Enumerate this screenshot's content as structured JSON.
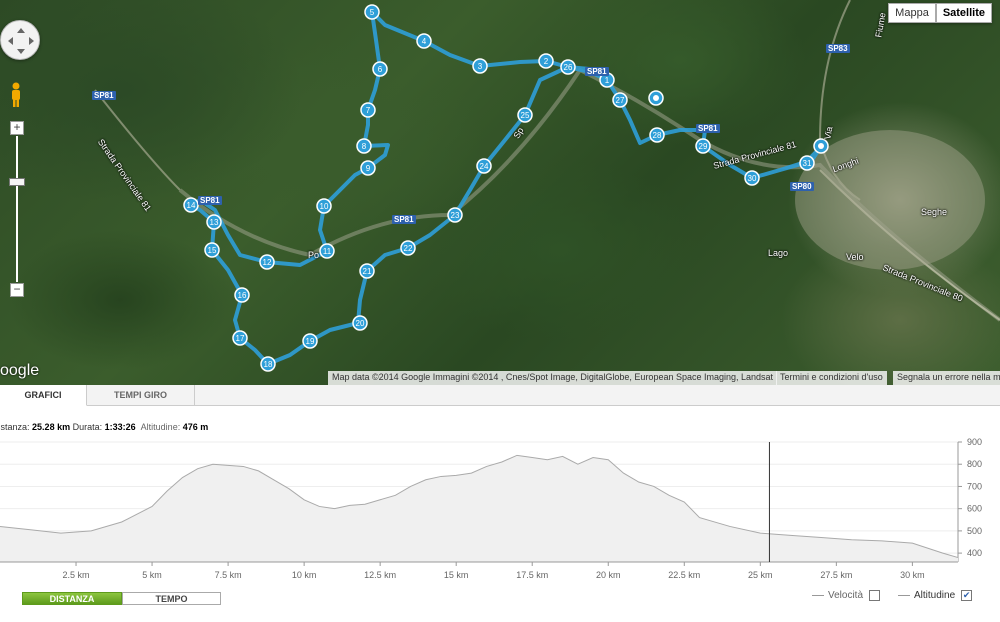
{
  "map": {
    "type_buttons": [
      "Mappa",
      "Satellite"
    ],
    "active_type": "Satellite",
    "google_logo": "oogle",
    "attribution": "Map data ©2014 Google Immagini ©2014 , Cnes/Spot Image, DigitalGlobe, European Space Imaging, Landsat",
    "terms": "Termini e condizioni d'uso",
    "report": "Segnala un errore nella m",
    "road_labels": [
      "SP81",
      "SP83",
      "SP81",
      "SP81",
      "SP81",
      "SP81",
      "SP80"
    ],
    "place_labels": [
      "Strada Provinciale 81",
      "Strada Provinciale 81",
      "Strada Provinciale 80",
      "Sp",
      "Lago",
      "Velo",
      "Seghe",
      "Fiume",
      "Longhi",
      "Po",
      "Via"
    ],
    "waypoints": [
      "1",
      "2",
      "3",
      "4",
      "5",
      "6",
      "7",
      "8",
      "9",
      "10",
      "11",
      "12",
      "13",
      "14",
      "15",
      "16",
      "17",
      "18",
      "19",
      "20",
      "21",
      "22",
      "23",
      "24",
      "25",
      "26",
      "27",
      "28",
      "29",
      "30",
      "31"
    ],
    "route_color": "#2f9fd8",
    "zoom_plus": "+",
    "zoom_minus": "−"
  },
  "tabs": [
    {
      "label": "GRAFICI",
      "active": true
    },
    {
      "label": "TEMPI GIRO",
      "active": false
    }
  ],
  "stats": {
    "distance_label": "Distanza:",
    "distance_value": "25.28 km",
    "duration_label": "Durata:",
    "duration_value": "1:33:26",
    "altitude_label": "Altitudine:",
    "altitude_value": "476 m"
  },
  "chart_data": {
    "type": "area",
    "xlabel": "",
    "ylabel": "",
    "x_ticks": [
      "2.5 km",
      "5 km",
      "7.5 km",
      "10 km",
      "12.5 km",
      "15 km",
      "17.5 km",
      "20 km",
      "22.5 km",
      "25 km",
      "27.5 km",
      "30 km"
    ],
    "y_ticks": [
      "400",
      "500",
      "600",
      "700",
      "800",
      "900"
    ],
    "xlim": [
      0,
      31.5
    ],
    "ylim": [
      360,
      900
    ],
    "cursor_x": 25.3,
    "series": [
      {
        "name": "Altitudine",
        "x": [
          0,
          1,
          2,
          3,
          4,
          5,
          5.5,
          6,
          6.5,
          7,
          7.5,
          8,
          8.5,
          9,
          9.5,
          10,
          10.5,
          11,
          11.5,
          12,
          12.5,
          13,
          13.5,
          14,
          14.5,
          15,
          15.5,
          16,
          16.5,
          17,
          17.5,
          18,
          18.5,
          19,
          19.5,
          20,
          20.5,
          21,
          21.5,
          22,
          22.5,
          23,
          24,
          25,
          26,
          27,
          28,
          29,
          30,
          31,
          31.5
        ],
        "y": [
          520,
          505,
          490,
          500,
          540,
          610,
          680,
          740,
          780,
          800,
          795,
          790,
          770,
          730,
          690,
          640,
          610,
          600,
          615,
          620,
          640,
          660,
          700,
          730,
          745,
          750,
          760,
          790,
          810,
          840,
          830,
          820,
          835,
          800,
          830,
          820,
          760,
          720,
          700,
          660,
          630,
          560,
          520,
          490,
          480,
          470,
          460,
          455,
          445,
          400,
          380
        ]
      }
    ]
  },
  "controls": {
    "segment": [
      {
        "label": "DISTANZA",
        "active": true
      },
      {
        "label": "TEMPO",
        "active": false
      }
    ],
    "legend_speed": "Velocità",
    "legend_altitude": "Altitudine",
    "speed_checked": false,
    "altitude_checked": true
  }
}
